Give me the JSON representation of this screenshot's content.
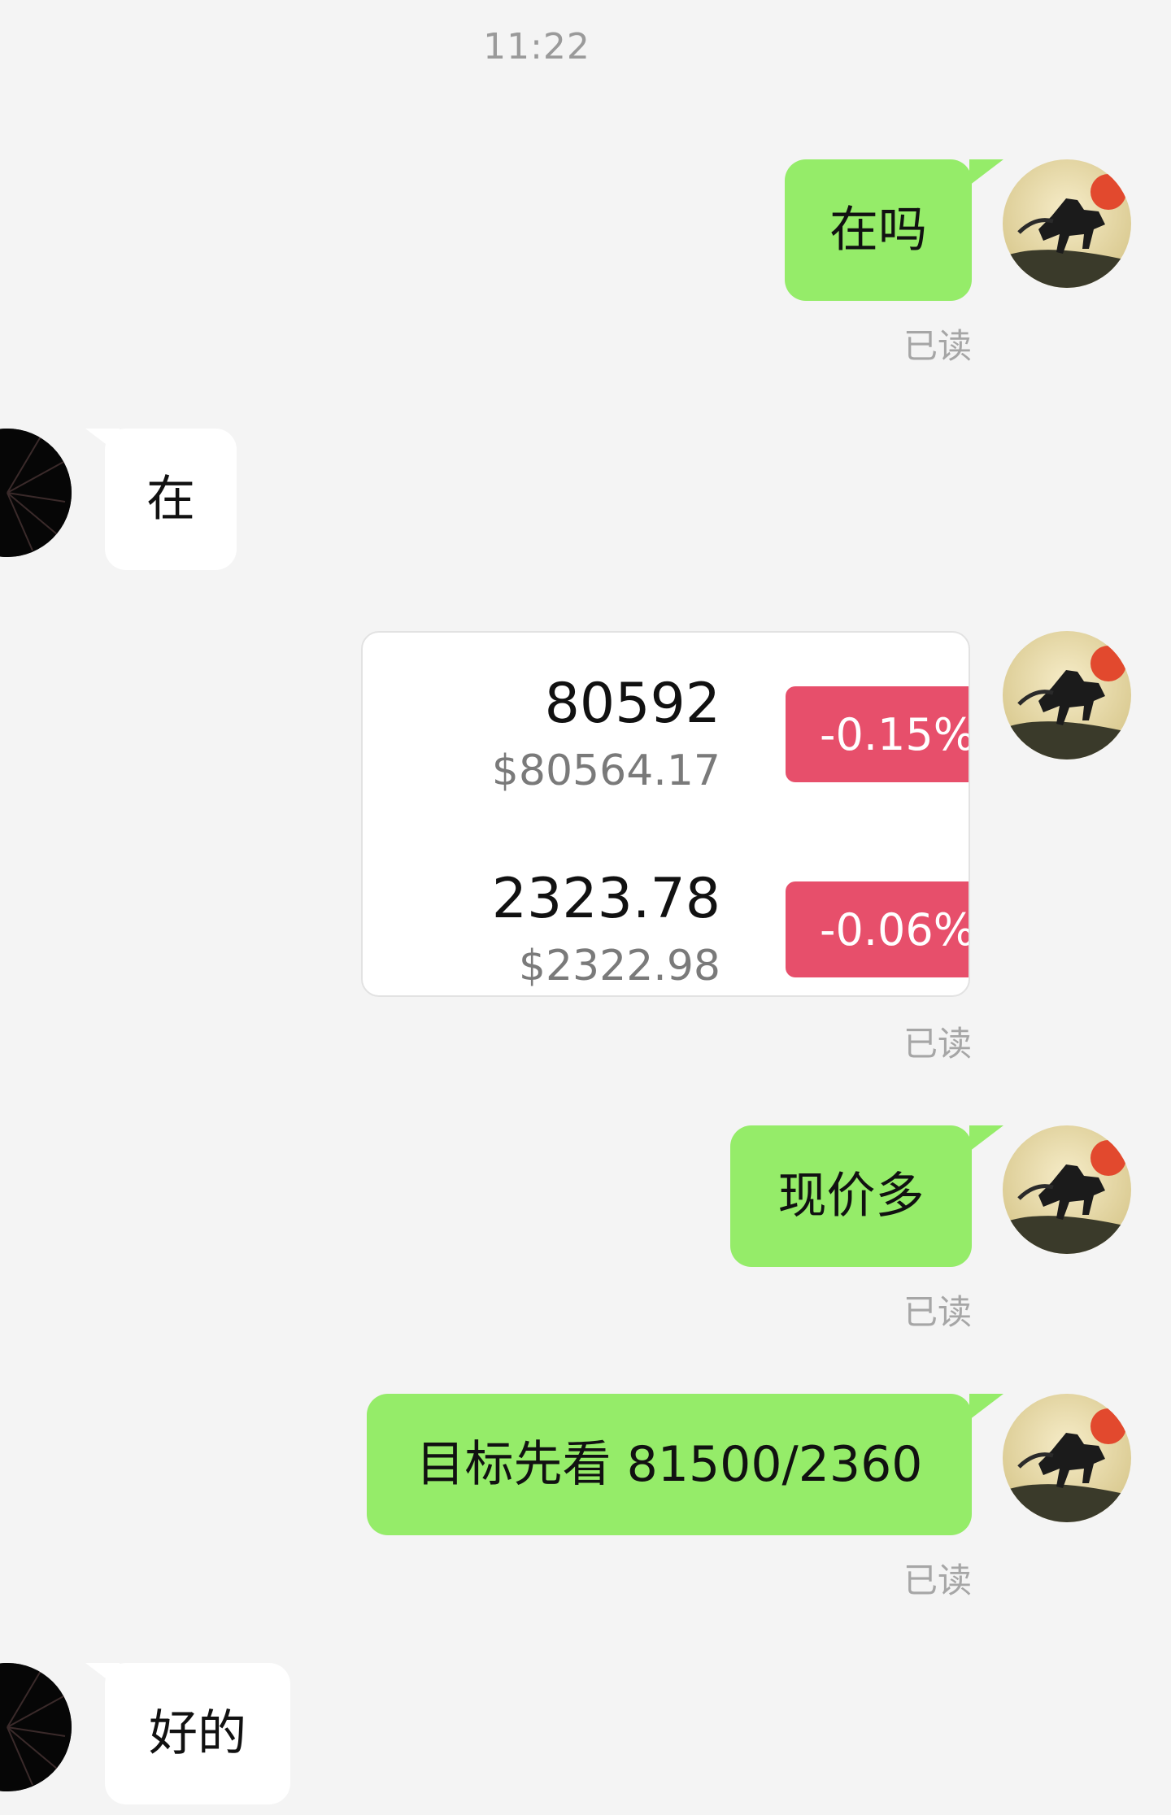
{
  "chat": {
    "timestamp": "11:22",
    "read_label": "已读",
    "messages": [
      {
        "from": "me",
        "text": "在吗",
        "status": "已读"
      },
      {
        "from": "other",
        "text": "在"
      },
      {
        "from": "me",
        "type": "quote_card",
        "status": "已读",
        "quotes": [
          {
            "price": "80592",
            "usd": "$80564.17",
            "change": "-0.15%"
          },
          {
            "price": "2323.78",
            "usd": "$2322.98",
            "change": "-0.06%"
          }
        ]
      },
      {
        "from": "me",
        "text": "现价多",
        "status": "已读"
      },
      {
        "from": "me",
        "text": "目标先看 81500/2360",
        "status": "已读"
      },
      {
        "from": "other",
        "text": "好的"
      }
    ]
  },
  "colors": {
    "background": "#f4f4f4",
    "my_bubble": "#95ec69",
    "other_bubble": "#ffffff",
    "negative_change": "#e74f6b",
    "read_text": "#a6a6a6"
  },
  "icons": {
    "my_avatar": "horse-painting-avatar",
    "other_avatar": "dark-firework-avatar"
  }
}
